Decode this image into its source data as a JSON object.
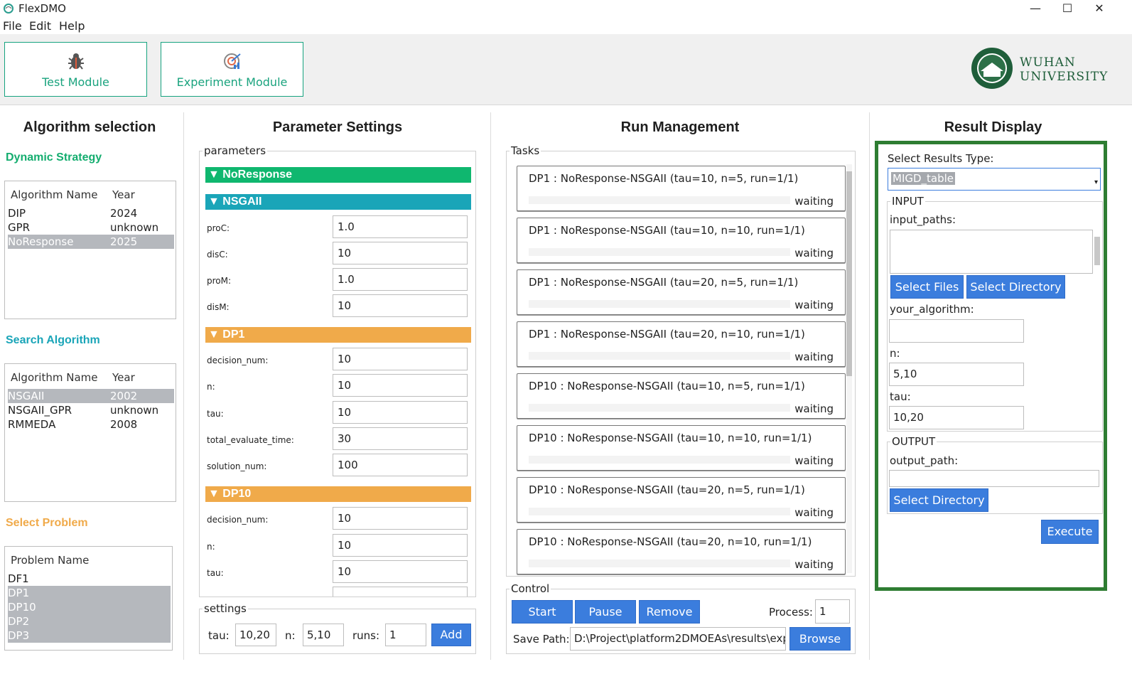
{
  "app": {
    "title": "FlexDMO",
    "minimize": "—",
    "maximize": "☐",
    "close": "✕"
  },
  "menu": [
    "File",
    "Edit",
    "Help"
  ],
  "modules": {
    "test": "Test Module",
    "experiment": "Experiment Module"
  },
  "logo": {
    "line1": "WUHAN",
    "line2": "UNIVERSITY"
  },
  "algorithm_selection": {
    "title": "Algorithm selection",
    "dynamic_strategy": {
      "label": "Dynamic Strategy",
      "col1": "Algorithm Name",
      "col2": "Year",
      "rows": [
        {
          "name": "DIP",
          "year": "2024"
        },
        {
          "name": "GPR",
          "year": "unknown"
        },
        {
          "name": "NoResponse",
          "year": "2025"
        }
      ]
    },
    "search_algorithm": {
      "label": "Search Algorithm",
      "col1": "Algorithm Name",
      "col2": "Year",
      "rows": [
        {
          "name": "NSGAII",
          "year": "2002"
        },
        {
          "name": "NSGAII_GPR",
          "year": "unknown"
        },
        {
          "name": "RMMEDA",
          "year": "2008"
        }
      ]
    },
    "select_problem": {
      "label": "Select Problem",
      "col1": "Problem Name",
      "rows": [
        "DF1",
        "DP1",
        "DP10",
        "DP2",
        "DP3"
      ]
    }
  },
  "parameter_settings": {
    "title": "Parameter Settings",
    "group": "parameters",
    "noresponse": "▼ NoResponse",
    "nsgaii": "▼ NSGAII",
    "nsgaii_params": [
      {
        "label": "proC:",
        "value": "1.0"
      },
      {
        "label": "disC:",
        "value": "10"
      },
      {
        "label": "proM:",
        "value": "1.0"
      },
      {
        "label": "disM:",
        "value": "10"
      }
    ],
    "dp1": "▼ DP1",
    "dp1_params": [
      {
        "label": "decision_num:",
        "value": "10"
      },
      {
        "label": "n:",
        "value": "10"
      },
      {
        "label": "tau:",
        "value": "10"
      },
      {
        "label": "total_evaluate_time:",
        "value": "30"
      },
      {
        "label": "solution_num:",
        "value": "100"
      }
    ],
    "dp10": "▼ DP10",
    "dp10_params": [
      {
        "label": "decision_num:",
        "value": "10"
      },
      {
        "label": "n:",
        "value": "10"
      },
      {
        "label": "tau:",
        "value": "10"
      }
    ],
    "settings": {
      "group": "settings",
      "tau_label": "tau:",
      "tau": "10,20",
      "n_label": "n:",
      "n": "5,10",
      "runs_label": "runs:",
      "runs": "1",
      "add": "Add"
    }
  },
  "run_management": {
    "title": "Run Management",
    "tasks_label": "Tasks",
    "tasks": [
      {
        "name": "DP1 : NoResponse-NSGAII (tau=10, n=5, run=1/1)",
        "status": "waiting"
      },
      {
        "name": "DP1 : NoResponse-NSGAII (tau=10, n=10, run=1/1)",
        "status": "waiting"
      },
      {
        "name": "DP1 : NoResponse-NSGAII (tau=20, n=5, run=1/1)",
        "status": "waiting"
      },
      {
        "name": "DP1 : NoResponse-NSGAII (tau=20, n=10, run=1/1)",
        "status": "waiting"
      },
      {
        "name": "DP10 : NoResponse-NSGAII (tau=10, n=5, run=1/1)",
        "status": "waiting"
      },
      {
        "name": "DP10 : NoResponse-NSGAII (tau=10, n=10, run=1/1)",
        "status": "waiting"
      },
      {
        "name": "DP10 : NoResponse-NSGAII (tau=20, n=5, run=1/1)",
        "status": "waiting"
      },
      {
        "name": "DP10 : NoResponse-NSGAII (tau=20, n=10, run=1/1)",
        "status": "waiting"
      }
    ],
    "control": {
      "label": "Control",
      "start": "Start",
      "pause": "Pause",
      "remove": "Remove",
      "process_label": "Process:",
      "process": "1",
      "save_label": "Save Path:",
      "save_path": "D:\\Project\\platform2DMOEAs\\results\\exp",
      "browse": "Browse"
    }
  },
  "result_display": {
    "title": "Result Display",
    "type_label": "Select Results Type:",
    "type_value": "MIGD_table",
    "input": {
      "label": "INPUT",
      "paths_label": "input_paths:",
      "select_files": "Select Files",
      "select_dir": "Select Directory",
      "alg_label": "your_algorithm:",
      "alg_value": "",
      "n_label": "n:",
      "n_value": "5,10",
      "tau_label": "tau:",
      "tau_value": "10,20"
    },
    "output": {
      "label": "OUTPUT",
      "path_label": "output_path:",
      "path_value": "",
      "select_dir": "Select Directory"
    },
    "execute": "Execute"
  },
  "colors": {
    "green": "#0fb76f",
    "teal": "#1aa5b8",
    "orange": "#f0aa4a",
    "blue": "#3b7ddd",
    "highlight": "#2e7d32"
  }
}
